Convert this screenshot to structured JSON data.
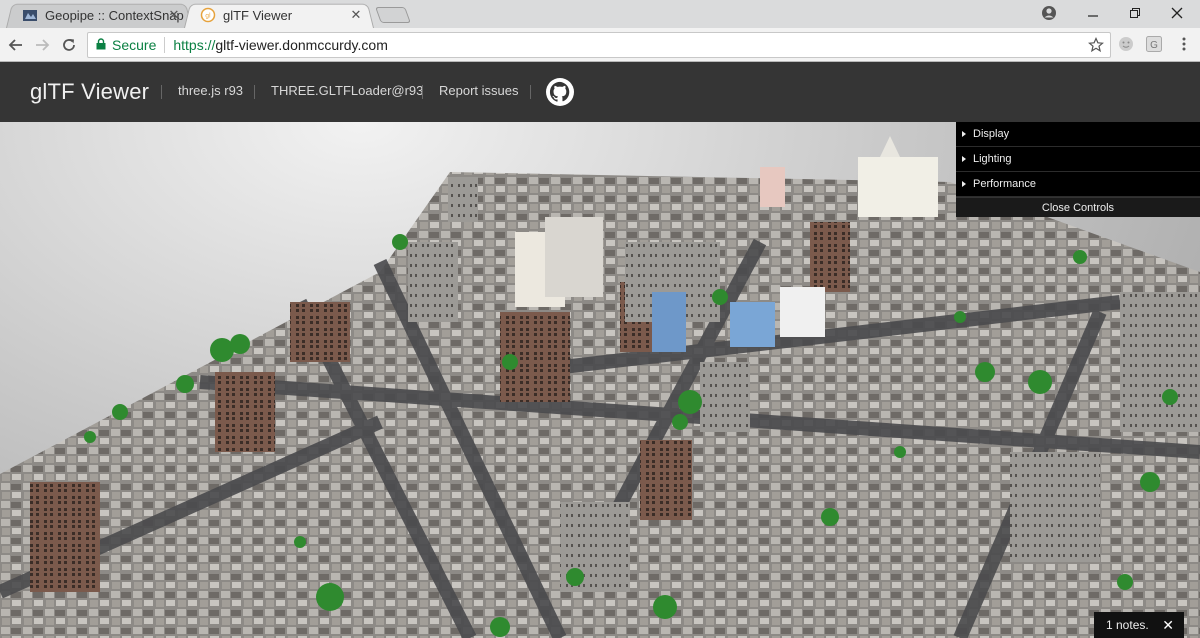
{
  "browser": {
    "tabs": [
      {
        "title": "Geopipe :: ContextSnap",
        "favicon": "geopipe-icon",
        "active": false
      },
      {
        "title": "glTF Viewer",
        "favicon": "gltf-viewer-icon",
        "active": true
      }
    ],
    "close_glyph": "✕",
    "nav": {
      "back": "back-arrow-icon",
      "forward": "forward-arrow-icon",
      "reload": "reload-icon"
    },
    "omnibox": {
      "security_label": "Secure",
      "url_scheme": "https://",
      "url_host": "gltf-viewer.donmccurdy.com"
    },
    "accent_green": "#0b8043"
  },
  "header": {
    "brand": "glTF Viewer",
    "links": [
      "three.js r93",
      "THREE.GLTFLoader@r93",
      "Report issues"
    ],
    "github": "github-icon"
  },
  "controls": {
    "folders": [
      "Display",
      "Lighting",
      "Performance"
    ],
    "close_label": "Close Controls"
  },
  "notes": {
    "text": "1 notes.",
    "close": "✕"
  }
}
